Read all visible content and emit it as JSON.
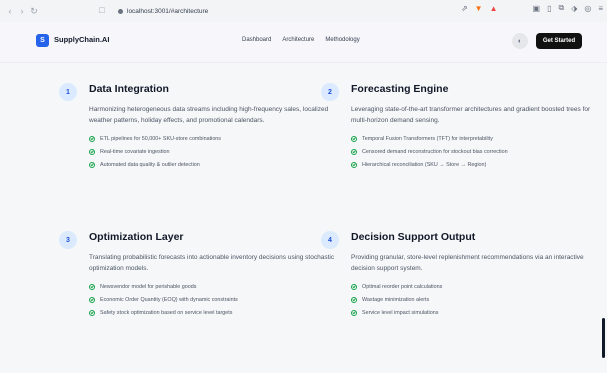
{
  "browser": {
    "url": "localhost:3001/#architecture",
    "nav_back": "‹",
    "nav_forward": "›",
    "nav_reload": "↻",
    "bookmark_icon": "□"
  },
  "header": {
    "logo_letter": "S",
    "brand": "SupplyChain.AI",
    "nav": [
      "Dashboard",
      "Architecture",
      "Methodology"
    ],
    "theme_icon": "◐",
    "cta_label": "Get Started"
  },
  "cards": [
    {
      "number": "1",
      "title": "Data Integration",
      "description": "Harmonizing heterogeneous data streams including high-frequency sales, localized weather patterns, holiday effects, and promotional calendars.",
      "items": [
        "ETL pipelines for 50,000+ SKU-store combinations",
        "Real-time covariate ingestion",
        "Automated data quality & outlier detection"
      ]
    },
    {
      "number": "2",
      "title": "Forecasting Engine",
      "description": "Leveraging state-of-the-art transformer architectures and gradient boosted trees for multi-horizon demand sensing.",
      "items": [
        "Temporal Fusion Transformers (TFT) for interpretability",
        "Censored demand reconstruction for stockout bias correction",
        "Hierarchical reconciliation (SKU → Store → Region)"
      ]
    },
    {
      "number": "3",
      "title": "Optimization Layer",
      "description": "Translating probabilistic forecasts into actionable inventory decisions using stochastic optimization models.",
      "items": [
        "Newsvendor model for perishable goods",
        "Economic Order Quantity (EOQ) with dynamic constraints",
        "Safety stock optimization based on service level targets"
      ]
    },
    {
      "number": "4",
      "title": "Decision Support Output",
      "description": "Providing granular, store-level replenishment recommendations via an interactive decision support system.",
      "items": [
        "Optimal reorder point calculations",
        "Wastage minimization alerts",
        "Service level impact simulations"
      ]
    }
  ]
}
